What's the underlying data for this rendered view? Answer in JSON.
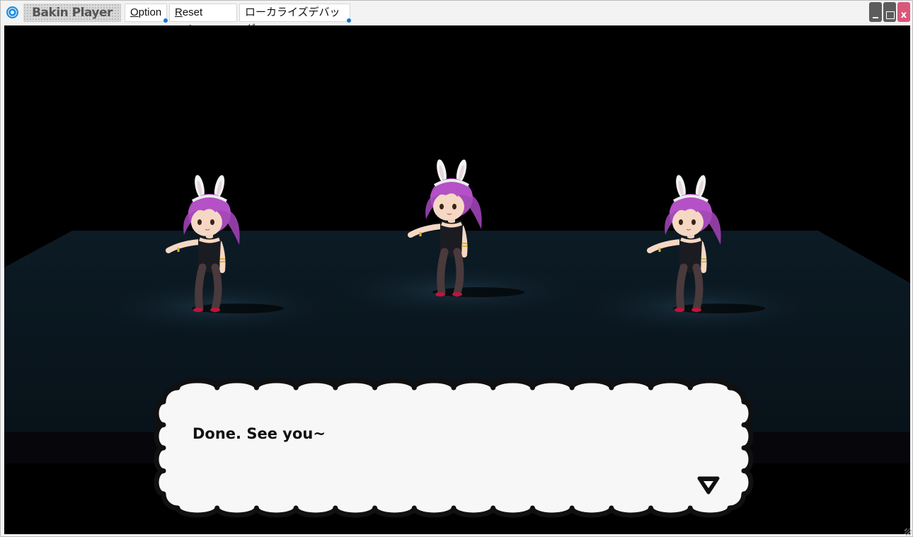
{
  "window": {
    "app_name": "Bakin Player",
    "menu": {
      "option": {
        "accel": "O",
        "rest": "ption"
      },
      "reset": {
        "accel": "R",
        "rest": "eset Ctrl+C"
      },
      "localize_debug": "ローカライズデバッグ"
    },
    "controls": {
      "close_glyph": "x"
    }
  },
  "scene": {
    "characters": 3
  },
  "dialogue": {
    "message": "Done. See you~",
    "next_indicator_icon": "triangle-down-icon"
  },
  "colors": {
    "background": "#000000",
    "stage": "#0a1820",
    "hair": "#a649b8",
    "bubble": "#f7f7f7",
    "accent_dot": "#1478d4",
    "close_button": "#d9587a"
  }
}
